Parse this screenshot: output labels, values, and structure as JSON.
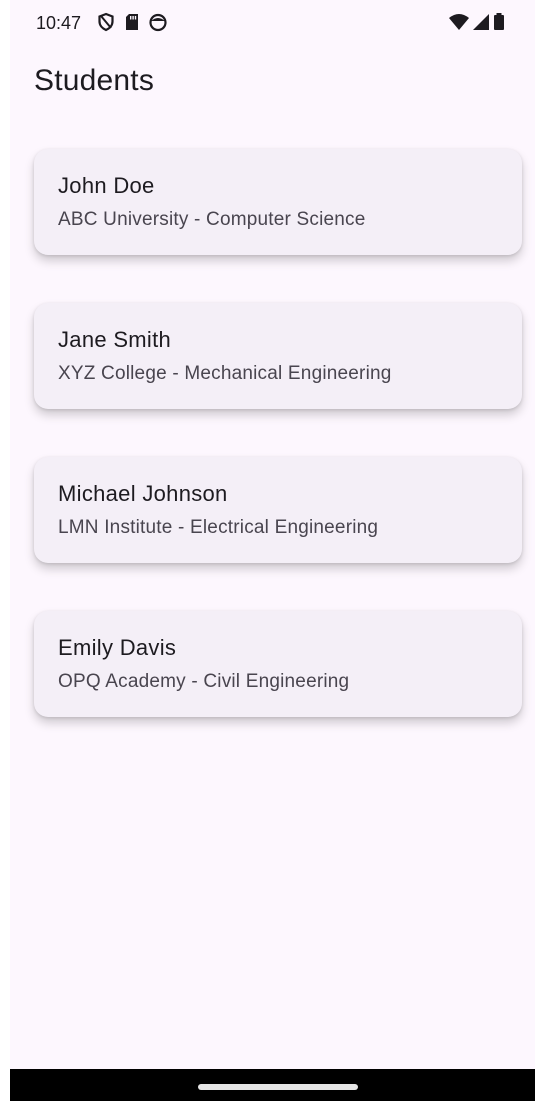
{
  "status_bar": {
    "time": "10:47",
    "left_icons": [
      "shield-icon",
      "sd-card-icon",
      "face-icon"
    ],
    "right_icons": [
      "wifi-icon",
      "cell-signal-icon",
      "battery-icon"
    ]
  },
  "header": {
    "title": "Students"
  },
  "students": [
    {
      "name": "John Doe",
      "detail": "ABC University - Computer Science"
    },
    {
      "name": "Jane Smith",
      "detail": "XYZ College - Mechanical Engineering"
    },
    {
      "name": "Michael Johnson",
      "detail": "LMN Institute - Electrical Engineering"
    },
    {
      "name": "Emily Davis",
      "detail": "OPQ Academy - Civil Engineering"
    }
  ],
  "colors": {
    "background": "#fdf7fe",
    "card": "#f4eff7",
    "text_primary": "#1d1b20",
    "text_secondary": "#49454f"
  }
}
